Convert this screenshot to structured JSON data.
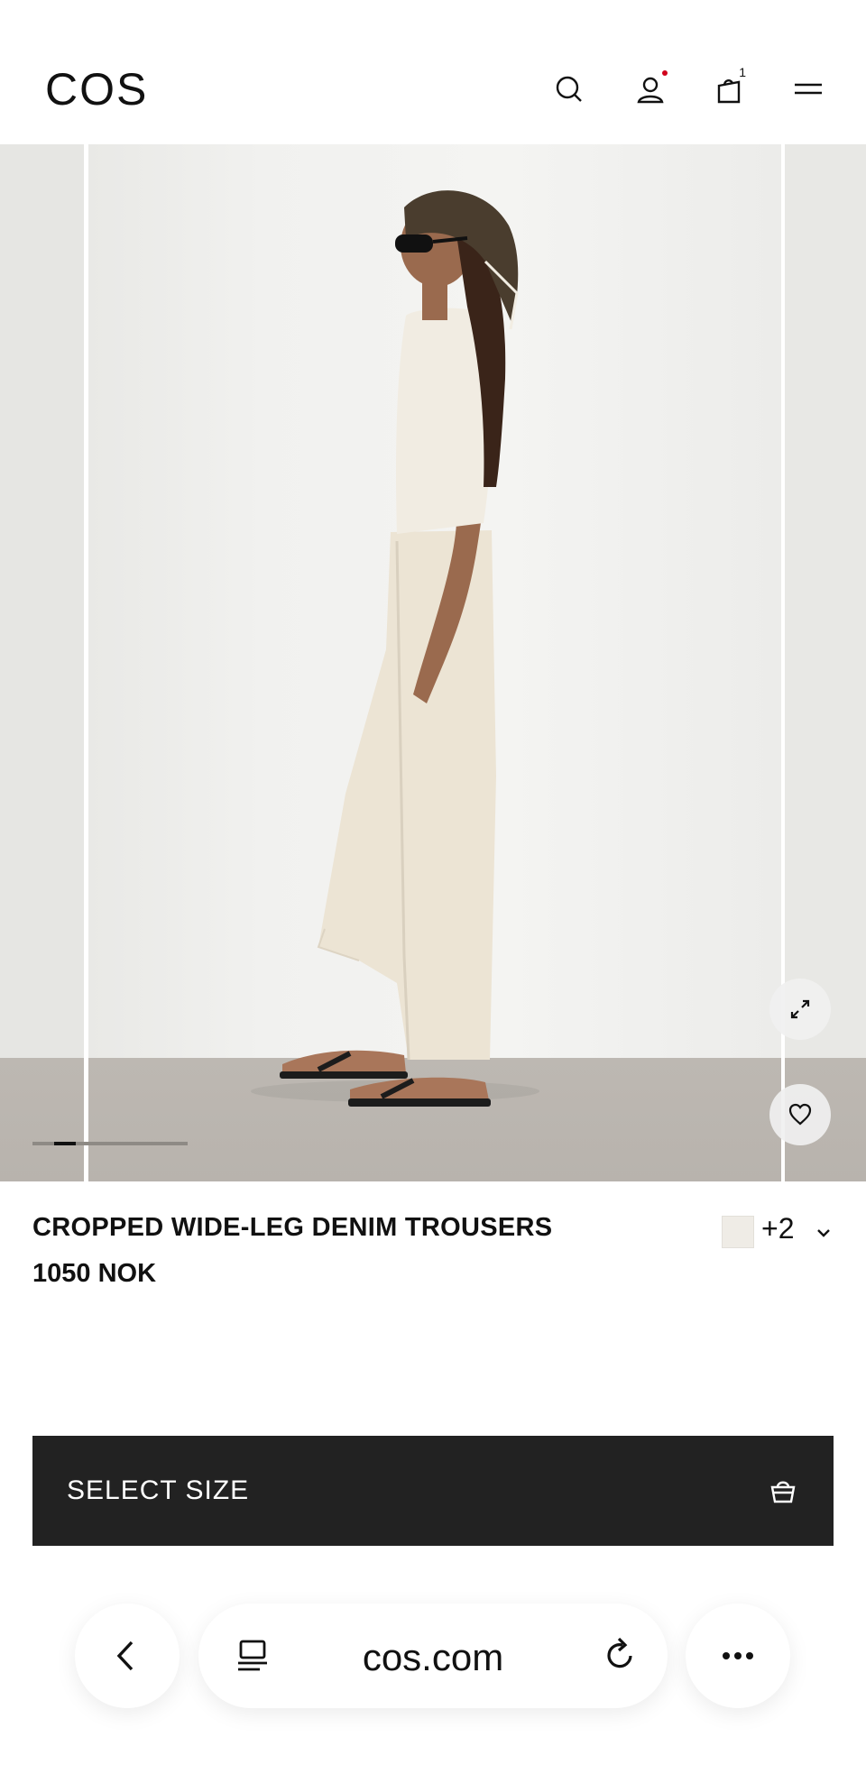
{
  "header": {
    "logo": "COS",
    "icons": [
      "search-icon",
      "account-icon",
      "bag-icon",
      "menu-icon"
    ],
    "bag_count": "1",
    "notification_dot_color": "#d0021b"
  },
  "gallery": {
    "expand_icon": "expand-icon",
    "wishlist_icon": "heart-icon",
    "current_image": 2
  },
  "product": {
    "name": "CROPPED WIDE-LEG DENIM TROUSERS",
    "price": "1050 NOK",
    "more_colors": "+2",
    "swatch_color": "#efece6"
  },
  "cta": {
    "label": "SELECT SIZE",
    "background": "#222222"
  },
  "browser": {
    "url": "cos.com",
    "icons": [
      "back-icon",
      "tabs-icon",
      "reload-icon",
      "more-icon"
    ]
  }
}
